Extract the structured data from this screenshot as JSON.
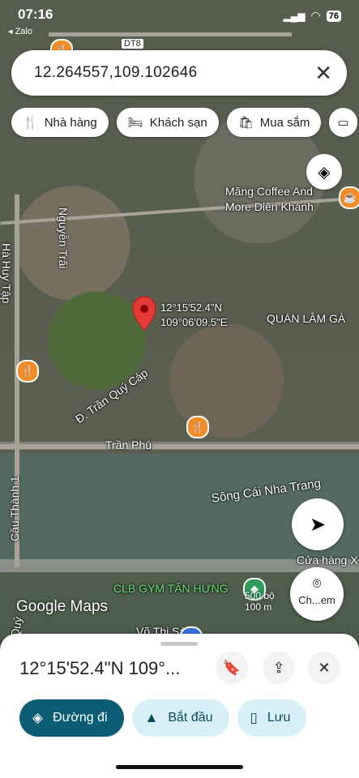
{
  "status_bar": {
    "time": "07:16",
    "back_label": "◂ Zalo",
    "battery": "76"
  },
  "search": {
    "value": "12.264557,109.102646"
  },
  "chips": [
    {
      "label": "Nhà hàng",
      "icon": "fork-knife-icon"
    },
    {
      "label": "Khách sạn",
      "icon": "bed-icon"
    },
    {
      "label": "Mua sắm",
      "icon": "shopping-bag-icon"
    }
  ],
  "map": {
    "pin_coords": [
      "12°15'52.4\"N",
      "109°06'09.5\"E"
    ],
    "labels": {
      "coffee": "Măng Coffee And More Diên Khánh",
      "quan_lam": "QUÁN LÂM GÀ",
      "nguyen_trai": "Nguyễn Trãi",
      "ha_huy_tap": "Hà Huy Tập",
      "tran_quy_cap": "Đ. Trần Quý Cáp",
      "tran_phu": "Trần Phú",
      "song_cai": "Sông Cái Nha Trang",
      "cau_thanh_1": "Cầu Thành 1",
      "cua_hang": "Cửa hàng X",
      "gym": "CLB GYM TẤN HƯNG",
      "vo_thi_sau": "Võ Thị Sáu",
      "dt8": "DT8",
      "quy": "Quý",
      "google_maps": "Google Maps",
      "scale_top": "500 bộ",
      "scale_bottom": "100 m"
    },
    "lens_label": "Ch...em"
  },
  "sheet": {
    "title": "12°15'52.4\"N 109°...",
    "actions": [
      {
        "label": "Đường đi",
        "icon": "directions-icon"
      },
      {
        "label": "Bắt đầu",
        "icon": "navigation-arrow-icon"
      },
      {
        "label": "Lưu",
        "icon": "bookmark-icon"
      }
    ]
  },
  "colors": {
    "primary": "#0b5c75",
    "secondary": "#d7f0f7",
    "pin": "#e53935",
    "poi": "#f28c28"
  }
}
